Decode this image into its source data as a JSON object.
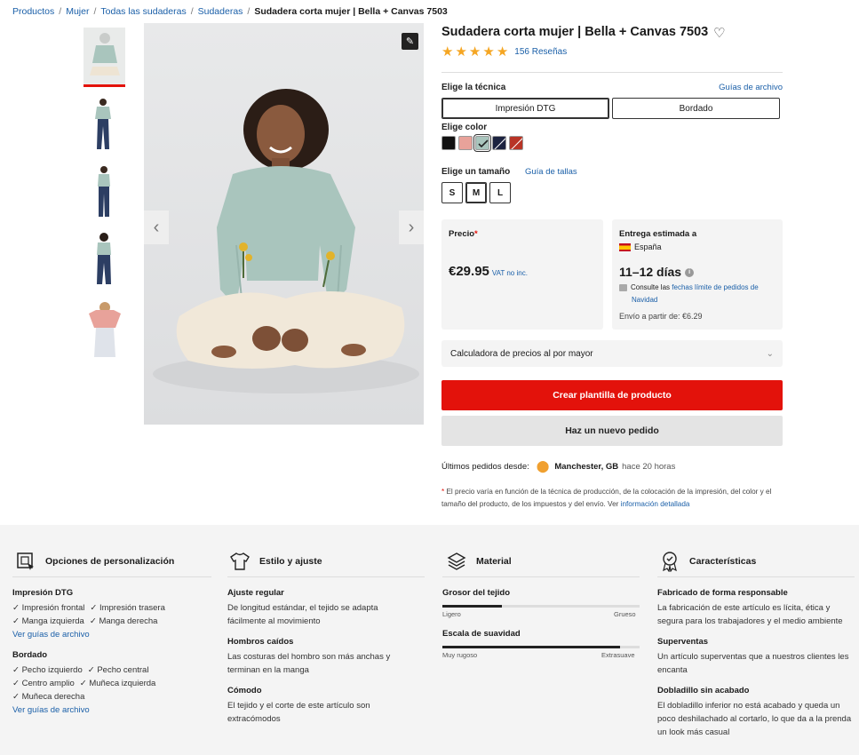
{
  "breadcrumb": {
    "items": [
      "Productos",
      "Mujer",
      "Todas las sudaderas",
      "Sudaderas"
    ],
    "current": "Sudadera corta mujer | Bella + Canvas 7503",
    "separator": "/"
  },
  "gallery": {
    "edit_icon": "pencil-icon",
    "prev_icon": "chevron-left-icon",
    "next_icon": "chevron-right-icon"
  },
  "product": {
    "title": "Sudadera corta mujer | Bella + Canvas 7503",
    "rating": 5,
    "reviews": "156 Reseñas"
  },
  "technique": {
    "label": "Elige la técnica",
    "guide_link": "Guías de archivo",
    "options": [
      "Impresión DTG",
      "Bordado"
    ],
    "selected": "Impresión DTG"
  },
  "color": {
    "label": "Elige color",
    "swatches": [
      "#111111",
      "#e8a29a",
      "#a9c5bd",
      "#1c2340",
      "#b83426"
    ],
    "selected_index": 2
  },
  "size": {
    "label": "Elige un tamaño",
    "guide_link": "Guía de tallas",
    "options": [
      "S",
      "M",
      "L"
    ],
    "selected": "M"
  },
  "price": {
    "label": "Precio",
    "asterisk": "*",
    "amount": "€29.95",
    "vat": "VAT no inc."
  },
  "delivery": {
    "label": "Entrega estimada a",
    "country": "España",
    "days": "11–12 días",
    "info_icon": "info-icon",
    "note_prefix": "Consulte las",
    "note_link": "fechas límite de pedidos de",
    "note_link2": "Navidad",
    "shipping": "Envío a partir de: €6.29"
  },
  "calculator": {
    "label": "Calculadora de precios al por mayor",
    "icon": "chevron-down-icon"
  },
  "actions": {
    "primary": "Crear plantilla de producto",
    "secondary": "Haz un nuevo pedido"
  },
  "recent_orders": {
    "label": "Últimos pedidos desde:",
    "location": "Manchester, GB",
    "time": "hace 20 horas"
  },
  "footnote": {
    "asterisk": "*",
    "text": "El precio varía en función de la técnica de producción, de la colocación de la impresión, del color y el tamaño del producto, de los impuestos y del envío. Ver",
    "link": "información detallada"
  },
  "features": {
    "customization": {
      "title": "Opciones de personalización",
      "dtg_title": "Impresión DTG",
      "dtg_row1": [
        "✓ Impresión frontal",
        "✓ Impresión trasera"
      ],
      "dtg_row2": [
        "✓ Manga izquierda",
        "✓ Manga derecha"
      ],
      "dtg_link": "Ver guías de archivo",
      "emb_title": "Bordado",
      "emb_row1": [
        "✓ Pecho izquierdo",
        "✓ Pecho central"
      ],
      "emb_row2": [
        "✓ Centro amplio",
        "✓ Muñeca izquierda"
      ],
      "emb_row3": [
        "✓ Muñeca derecha"
      ],
      "emb_link": "Ver guías de archivo"
    },
    "style": {
      "title": "Estilo y ajuste",
      "items": [
        {
          "title": "Ajuste regular",
          "text": "De longitud estándar, el tejido se adapta fácilmente al movimiento"
        },
        {
          "title": "Hombros caídos",
          "text": "Las costuras del hombro son más anchas y terminan en la manga"
        },
        {
          "title": "Cómodo",
          "text": "El tejido y el corte de este artículo son extracómodos"
        }
      ]
    },
    "material": {
      "title": "Material",
      "thickness": {
        "label": "Grosor del tejido",
        "min": "Ligero",
        "max": "Grueso",
        "value": 0.3
      },
      "softness": {
        "label": "Escala de suavidad",
        "min": "Muy rugoso",
        "max": "Extrasuave",
        "value": 0.9
      }
    },
    "characteristics": {
      "title": "Características",
      "items": [
        {
          "title": "Fabricado de forma responsable",
          "text": "La fabricación de este artículo es lícita, ética y segura para los trabajadores y el medio ambiente"
        },
        {
          "title": "Superventas",
          "text": "Un artículo superventas que a nuestros clientes les encanta"
        },
        {
          "title": "Dobladillo sin acabado",
          "text": "El dobladillo inferior no está acabado y queda un poco deshilachado al cortarlo, lo que da a la prenda un look más casual"
        }
      ]
    }
  }
}
